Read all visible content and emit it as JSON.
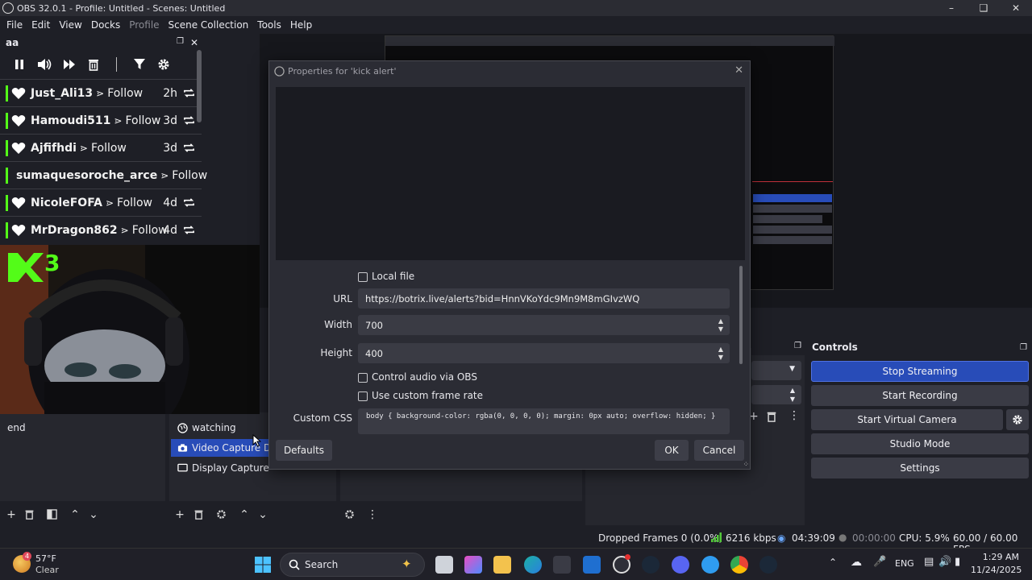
{
  "window": {
    "title": "OBS 32.0.1 - Profile: Untitled - Scenes: Untitled"
  },
  "menu": [
    "File",
    "Edit",
    "View",
    "Docks",
    "Profile",
    "Scene Collection",
    "Tools",
    "Help"
  ],
  "chat_dock": {
    "title": "aa",
    "events": [
      {
        "user": "Just_Ali13",
        "action": "Follow",
        "time": "2h"
      },
      {
        "user": "Hamoudi511",
        "action": "Follow",
        "time": "3d"
      },
      {
        "user": "Ajfifhdi",
        "action": "Follow",
        "time": "3d"
      },
      {
        "user": "sumaquesoroche_arce",
        "action": "Follow",
        "time": ""
      },
      {
        "user": "NicoleFOFA",
        "action": "Follow",
        "time": "4d"
      },
      {
        "user": "MrDragon862",
        "action": "Follow",
        "time": "4d"
      }
    ],
    "arrow": "⋗"
  },
  "webcam": {
    "badge": "3"
  },
  "scenes": {
    "items": [
      "end"
    ]
  },
  "sources": {
    "items": [
      {
        "label": "watching",
        "selected": false
      },
      {
        "label": "Video Capture Dev",
        "selected": true
      },
      {
        "label": "Display Capture",
        "selected": false
      }
    ]
  },
  "controls": {
    "title": "Controls",
    "buttons": [
      "Stop Streaming",
      "Start Recording",
      "Start Virtual Camera",
      "Studio Mode",
      "Settings"
    ]
  },
  "status": {
    "dropped": "Dropped Frames 0 (0.0%)",
    "kbps": "6216 kbps",
    "stream_time": "04:39:09",
    "rec_time": "00:00:00",
    "cpu": "CPU: 5.9%",
    "fps": "60.00 / 60.00 FPS"
  },
  "dialog": {
    "title": "Properties for 'kick alert'",
    "local_file_label": "Local file",
    "url_label": "URL",
    "url_value": "https://botrix.live/alerts?bid=HnnVKoYdc9Mn9M8mGIvzWQ",
    "width_label": "Width",
    "width_value": "700",
    "height_label": "Height",
    "height_value": "400",
    "control_audio_label": "Control audio via OBS",
    "custom_frame_label": "Use custom frame rate",
    "css_label": "Custom CSS",
    "css_value": "body { background-color: rgba(0, 0, 0, 0); margin: 0px auto; overflow: hidden; }",
    "defaults_btn": "Defaults",
    "ok_btn": "OK",
    "cancel_btn": "Cancel"
  },
  "taskbar": {
    "weather_temp": "57°F",
    "weather_cond": "Clear",
    "weather_badge": "4",
    "search": "Search",
    "lang": "ENG",
    "time": "1:29 AM",
    "date": "11/24/2025"
  },
  "colors": {
    "accent": "#284cb8",
    "kick_green": "#53fc18",
    "bg": "#1e1f26"
  }
}
